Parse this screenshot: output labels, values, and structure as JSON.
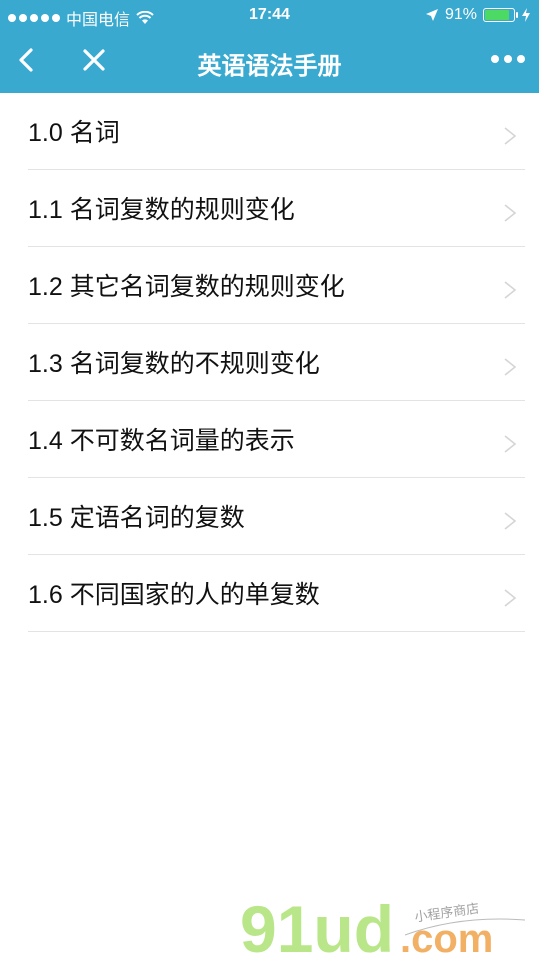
{
  "status_bar": {
    "carrier": "中国电信",
    "time": "17:44",
    "battery": "91%",
    "battery_level": 0.91
  },
  "nav": {
    "title": "英语语法手册",
    "back_icon": "chevron-left-icon",
    "close_icon": "close-icon",
    "more_icon": "more-dots-icon"
  },
  "list": {
    "items": [
      {
        "label": "1.0 名词"
      },
      {
        "label": "1.1 名词复数的规则变化"
      },
      {
        "label": "1.2 其它名词复数的规则变化"
      },
      {
        "label": "1.3 名词复数的不规则变化"
      },
      {
        "label": "1.4 不可数名词量的表示"
      },
      {
        "label": "1.5 定语名词的复数"
      },
      {
        "label": "1.6 不同国家的人的单复数"
      }
    ]
  },
  "watermark": {
    "brand": "91ud",
    "domain": ".com",
    "tagline": "小程序商店"
  }
}
